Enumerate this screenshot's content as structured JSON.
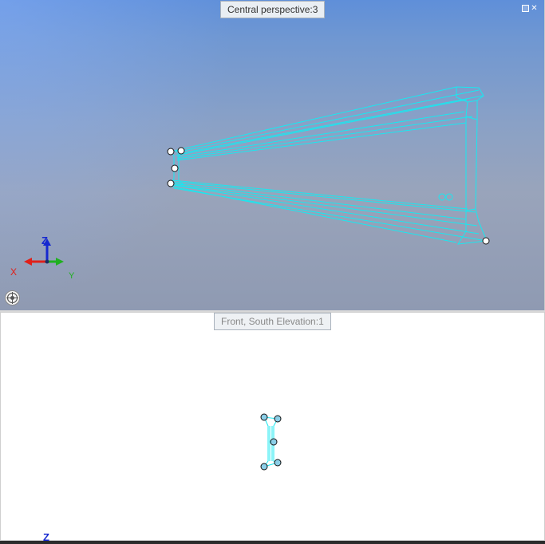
{
  "top_view": {
    "title": "Central perspective:3",
    "axis_labels": {
      "x": "X",
      "y": "Y",
      "z": "Z"
    },
    "colors": {
      "background_top": "#5f8fd9",
      "background_bottom": "#8f9ab2",
      "wireframe": "#18e8f0",
      "x_axis": "#e0201a",
      "y_axis": "#20b020",
      "z_axis": "#1528d0"
    },
    "icons": {
      "maximize": "maximize-icon",
      "close": "close-icon",
      "navigation": "navigation-wheel-icon"
    }
  },
  "bottom_view": {
    "title": "Front, South Elevation:1",
    "axis_labels": {
      "z": "Z"
    },
    "colors": {
      "wireframe": "#18e8f0",
      "grip": "#8ccfe8",
      "z_axis": "#1528d0"
    }
  }
}
